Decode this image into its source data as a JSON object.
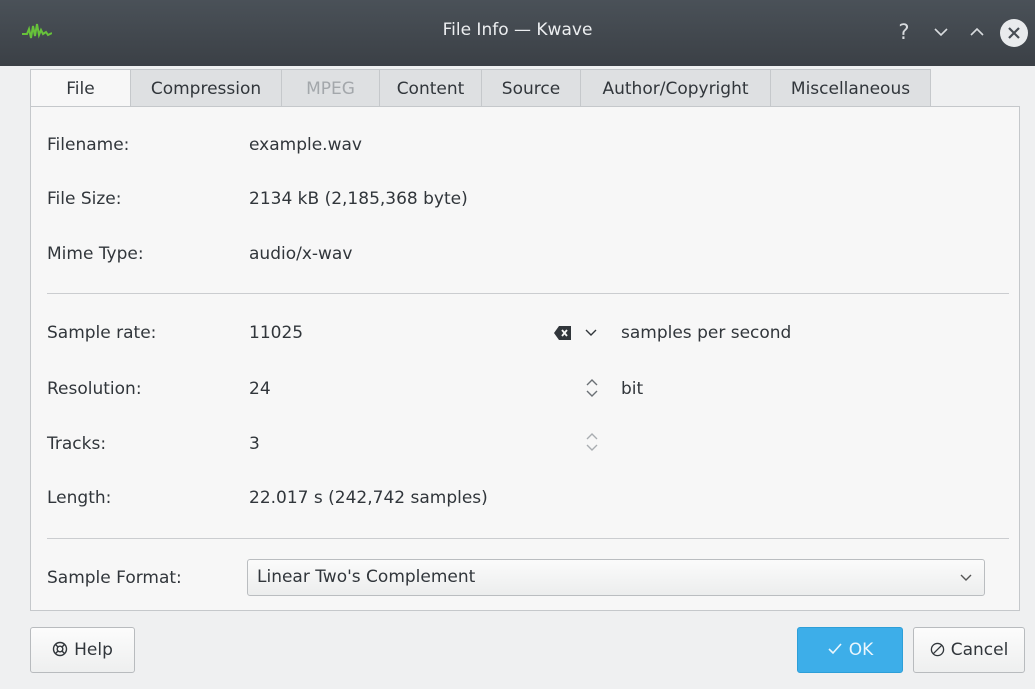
{
  "window": {
    "title": "File Info — Kwave",
    "controls": {
      "help": "?",
      "minimize": "⌄",
      "maximize": "⌃",
      "close": "✕"
    }
  },
  "tabs": [
    {
      "label": "File",
      "state": "active"
    },
    {
      "label": "Compression",
      "state": "normal"
    },
    {
      "label": "MPEG",
      "state": "disabled"
    },
    {
      "label": "Content",
      "state": "normal"
    },
    {
      "label": "Source",
      "state": "normal"
    },
    {
      "label": "Author/Copyright",
      "state": "normal"
    },
    {
      "label": "Miscellaneous",
      "state": "normal"
    }
  ],
  "file": {
    "filename_label": "Filename:",
    "filename_value": "example.wav",
    "filesize_label": "File Size:",
    "filesize_value": "2134 kB (2,185,368 byte)",
    "mimetype_label": "Mime Type:",
    "mimetype_value": "audio/x-wav"
  },
  "audio": {
    "samplerate_label": "Sample rate:",
    "samplerate_value": "11025",
    "samplerate_unit": "samples per second",
    "resolution_label": "Resolution:",
    "resolution_value": "24",
    "resolution_unit": "bit",
    "tracks_label": "Tracks:",
    "tracks_value": "3",
    "length_label": "Length:",
    "length_value": "22.017 s (242,742 samples)"
  },
  "format": {
    "label": "Sample Format:",
    "selected": "Linear Two's Complement"
  },
  "buttons": {
    "help": "Help",
    "ok": "OK",
    "cancel": "Cancel"
  },
  "colors": {
    "titlebar": "#3b4046",
    "accent": "#3daee9",
    "disabled_text": "#a3a7ab"
  }
}
